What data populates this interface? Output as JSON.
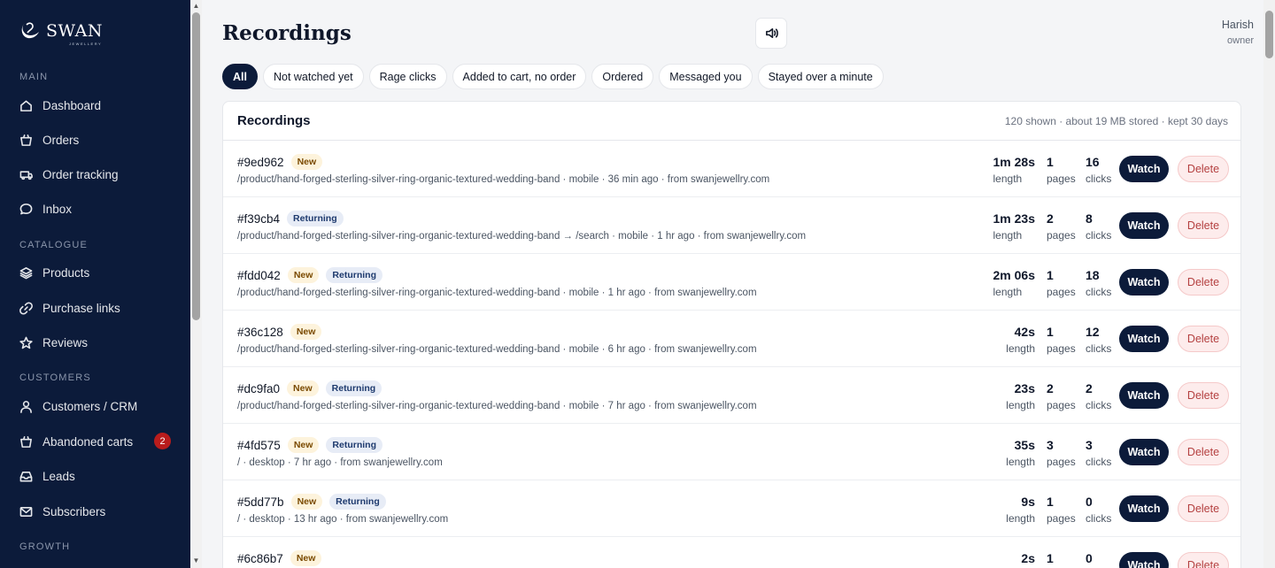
{
  "brand": {
    "name": "SWAN",
    "sub": "JEWELLERY"
  },
  "sidebar": {
    "sections": [
      {
        "label": "MAIN",
        "items": [
          {
            "label": "Dashboard",
            "icon": "home-icon"
          },
          {
            "label": "Orders",
            "icon": "basket-icon"
          },
          {
            "label": "Order tracking",
            "icon": "truck-icon"
          },
          {
            "label": "Inbox",
            "icon": "chat-icon"
          }
        ]
      },
      {
        "label": "CATALOGUE",
        "items": [
          {
            "label": "Products",
            "icon": "layers-icon"
          },
          {
            "label": "Purchase links",
            "icon": "link-icon"
          },
          {
            "label": "Reviews",
            "icon": "star-icon"
          }
        ]
      },
      {
        "label": "CUSTOMERS",
        "items": [
          {
            "label": "Customers / CRM",
            "icon": "user-icon"
          },
          {
            "label": "Abandoned carts",
            "icon": "basket-icon",
            "badge": "2"
          },
          {
            "label": "Leads",
            "icon": "inbox-icon"
          },
          {
            "label": "Subscribers",
            "icon": "mail-icon"
          }
        ]
      },
      {
        "label": "GROWTH",
        "items": []
      }
    ]
  },
  "header": {
    "title": "Recordings",
    "sound_icon": "speaker-icon"
  },
  "user": {
    "name": "Harish",
    "role": "owner"
  },
  "filters": [
    "All",
    "Not watched yet",
    "Rage clicks",
    "Added to cart, no order",
    "Ordered",
    "Messaged you",
    "Stayed over a minute"
  ],
  "card": {
    "title": "Recordings",
    "meta": "120 shown · about 19 MB stored · kept 30 days",
    "labels": {
      "length": "length",
      "pages": "pages",
      "clicks": "clicks",
      "watch": "Watch",
      "delete": "Delete",
      "new": "New",
      "returning": "Returning"
    },
    "rows": [
      {
        "id": "#9ed962",
        "new": true,
        "returning": false,
        "path": "/product/hand-forged-sterling-silver-ring-organic-textured-wedding-band · mobile · 36 min ago · from swanjewellry.com",
        "length": "1m 28s",
        "pages": "1",
        "clicks": "16"
      },
      {
        "id": "#f39cb4",
        "new": false,
        "returning": true,
        "path": "/product/hand-forged-sterling-silver-ring-organic-textured-wedding-band → /search · mobile · 1 hr ago · from swanjewellry.com",
        "length": "1m 23s",
        "pages": "2",
        "clicks": "8"
      },
      {
        "id": "#fdd042",
        "new": true,
        "returning": true,
        "path": "/product/hand-forged-sterling-silver-ring-organic-textured-wedding-band · mobile · 1 hr ago · from swanjewellry.com",
        "length": "2m 06s",
        "pages": "1",
        "clicks": "18"
      },
      {
        "id": "#36c128",
        "new": true,
        "returning": false,
        "path": "/product/hand-forged-sterling-silver-ring-organic-textured-wedding-band · mobile · 6 hr ago · from swanjewellry.com",
        "length": "42s",
        "pages": "1",
        "clicks": "12"
      },
      {
        "id": "#dc9fa0",
        "new": true,
        "returning": true,
        "path": "/product/hand-forged-sterling-silver-ring-organic-textured-wedding-band · mobile · 7 hr ago · from swanjewellry.com",
        "length": "23s",
        "pages": "2",
        "clicks": "2"
      },
      {
        "id": "#4fd575",
        "new": true,
        "returning": true,
        "path": "/ · desktop · 7 hr ago · from swanjewellry.com",
        "length": "35s",
        "pages": "3",
        "clicks": "3"
      },
      {
        "id": "#5dd77b",
        "new": true,
        "returning": true,
        "path": "/ · desktop · 13 hr ago · from swanjewellry.com",
        "length": "9s",
        "pages": "1",
        "clicks": "0"
      },
      {
        "id": "#6c86b7",
        "new": true,
        "returning": false,
        "path": "",
        "length": "2s",
        "pages": "1",
        "clicks": "0"
      }
    ]
  }
}
